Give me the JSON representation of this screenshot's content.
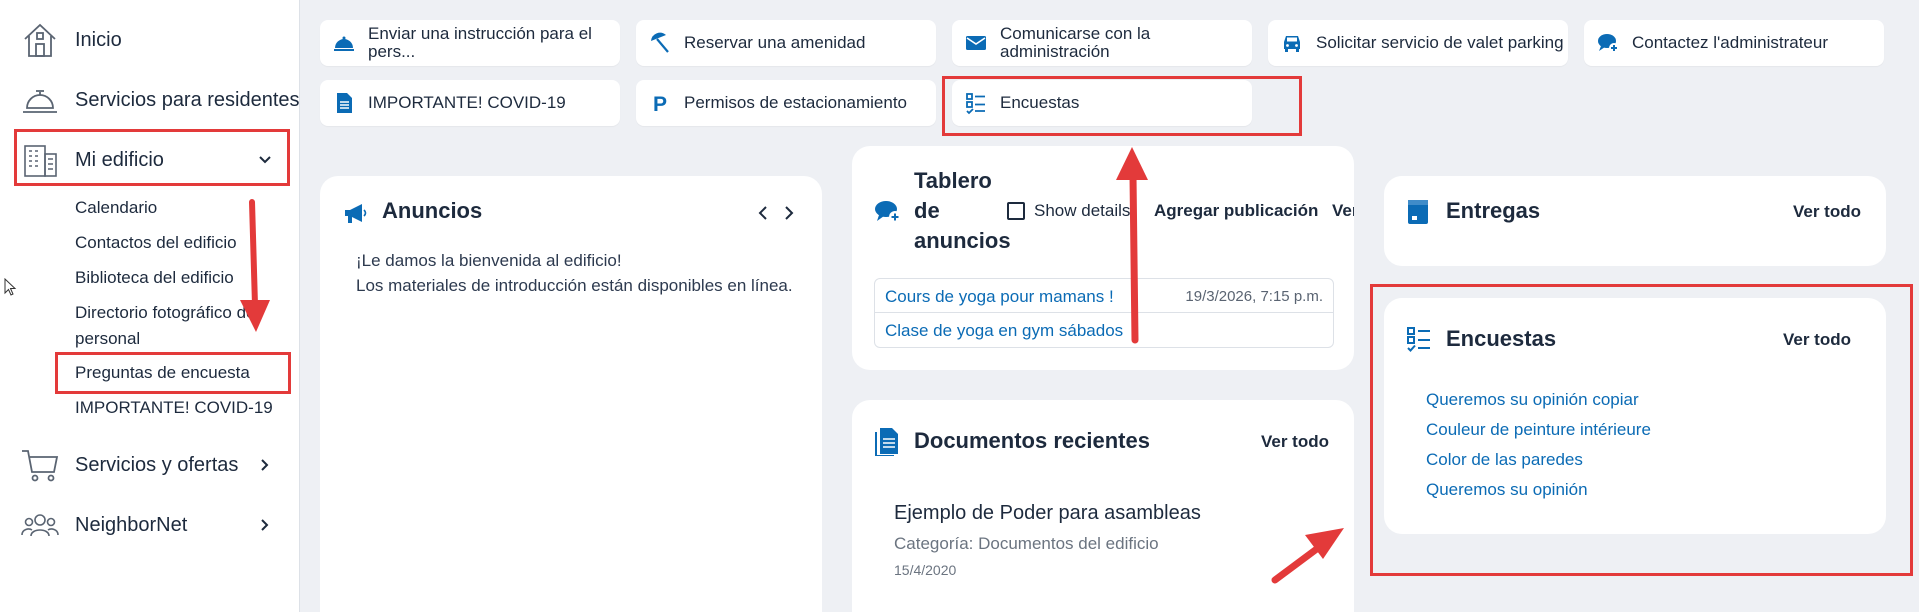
{
  "sidebar": {
    "items": [
      {
        "label": "Inicio",
        "icon": "house-icon"
      },
      {
        "label": "Servicios para residentes",
        "icon": "concierge-bell-icon"
      },
      {
        "label": "Mi edificio",
        "icon": "building-icon"
      },
      {
        "label": "Servicios y ofertas",
        "icon": "cart-icon"
      },
      {
        "label": "NeighborNet",
        "icon": "people-icon"
      }
    ],
    "submenu": [
      "Calendario",
      "Contactos del edificio",
      "Biblioteca del edificio",
      "Directorio fotográfico del personal",
      "Preguntas de encuesta",
      "IMPORTANTE! COVID-19"
    ]
  },
  "quick_actions": [
    {
      "label": "Enviar una instrucción para el pers...",
      "icon": "bell-icon"
    },
    {
      "label": "Reservar una amenidad",
      "icon": "beach-umbrella-icon"
    },
    {
      "label": "Comunicarse con la administración",
      "icon": "envelope-icon"
    },
    {
      "label": "Solicitar servicio de valet parking",
      "icon": "car-icon"
    },
    {
      "label": "Contactez l'administrateur",
      "icon": "chat-plus-icon"
    },
    {
      "label": "IMPORTANTE! COVID-19",
      "icon": "document-icon"
    },
    {
      "label": "Permisos de estacionamiento",
      "icon": "parking-icon"
    },
    {
      "label": "Encuestas",
      "icon": "checklist-icon"
    }
  ],
  "announcements": {
    "title": "Anuncios",
    "line1": "¡Le damos la bienvenida al edificio!",
    "line2": "Los materiales de introducción están disponibles en línea."
  },
  "bulletin": {
    "title": "Tablero de anuncios",
    "show_details": "Show details",
    "add_post": "Agregar publicación",
    "see_all": "Ver todo",
    "posts": [
      {
        "title": "Cours de yoga pour mamans !",
        "date": "19/3/2026, 7:15 p.m."
      },
      {
        "title": "Clase de yoga en gym sábados",
        "date": ""
      }
    ]
  },
  "documents": {
    "title": "Documentos recientes",
    "see_all": "Ver todo",
    "doc_title": "Ejemplo de Poder para asambleas",
    "doc_category": "Categoría: Documentos del edificio",
    "doc_date": "15/4/2020"
  },
  "deliveries": {
    "title": "Entregas",
    "see_all": "Ver todo"
  },
  "surveys": {
    "title": "Encuestas",
    "see_all": "Ver todo",
    "items": [
      "Queremos su opinión copiar",
      "Couleur de peinture intérieure",
      "Color de las paredes",
      "Queremos su opinión"
    ]
  },
  "colors": {
    "accent": "#0b6bb5",
    "annotation": "#e33a3a",
    "text": "#1d2a3d"
  }
}
